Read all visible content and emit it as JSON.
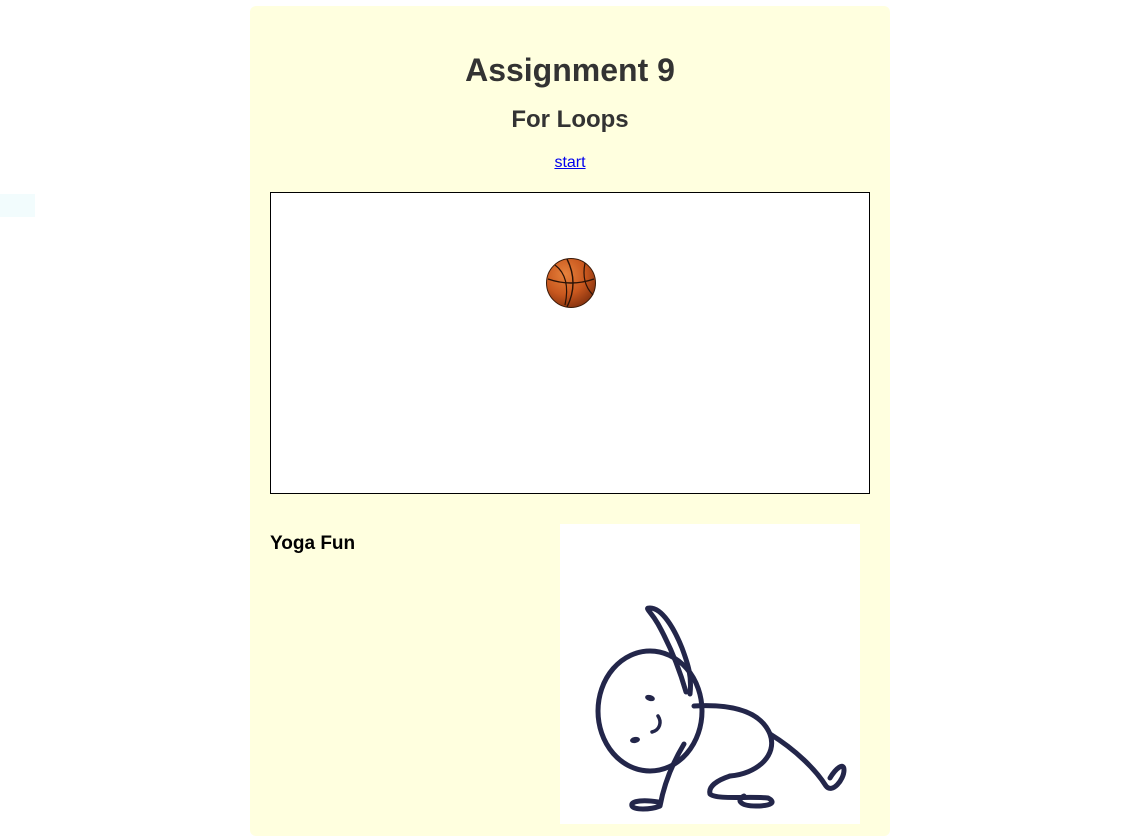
{
  "page": {
    "title": "Assignment 9",
    "subtitle": "For Loops",
    "start_link": "start"
  },
  "canvas": {
    "ball_icon": "basketball-icon"
  },
  "yoga": {
    "heading": "Yoga Fun",
    "image_icon": "stick-figure-yoga-illustration"
  },
  "colors": {
    "card_background": "#ffffdf",
    "heading_text": "#333333",
    "link": "#0000ee",
    "ball": "#c8571e",
    "figure_stroke": "#23264a"
  }
}
